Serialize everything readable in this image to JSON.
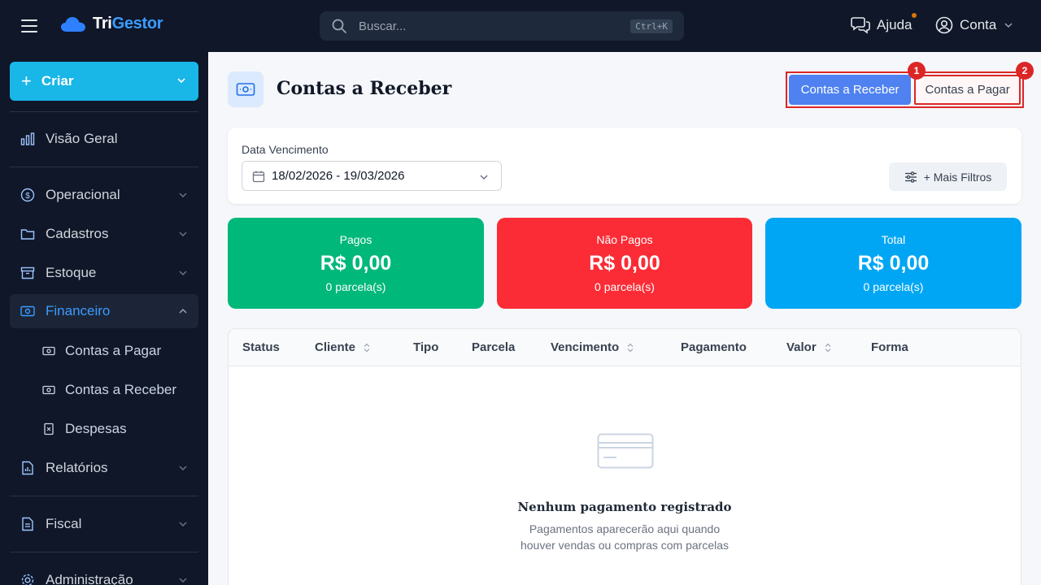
{
  "topbar": {
    "logo_prefix": "Tri",
    "logo_suffix": "Gestor",
    "search_placeholder": "Buscar...",
    "search_shortcut": "Ctrl+K",
    "help_label": "Ajuda",
    "account_label": "Conta"
  },
  "sidebar": {
    "create_label": "Criar",
    "items": {
      "visao_geral": "Visão Geral",
      "operacional": "Operacional",
      "cadastros": "Cadastros",
      "estoque": "Estoque",
      "financeiro": "Financeiro",
      "relatorios": "Relatórios",
      "fiscal": "Fiscal",
      "administracao": "Administração"
    },
    "financeiro_sub": {
      "contas_pagar": "Contas a Pagar",
      "contas_receber": "Contas a Receber",
      "despesas": "Despesas"
    }
  },
  "page": {
    "title": "Contas a Receber",
    "tabs": {
      "receber": "Contas a Receber",
      "pagar": "Contas a Pagar"
    },
    "badges": [
      "1",
      "2"
    ]
  },
  "filters": {
    "date_label": "Data Vencimento",
    "date_value": "18/02/2026 - 19/03/2026",
    "more_filters": "+ Mais Filtros"
  },
  "stats": {
    "pagos": {
      "label": "Pagos",
      "value": "R$ 0,00",
      "count": "0 parcela(s)",
      "color": "#00b879"
    },
    "nao_pagos": {
      "label": "Não Pagos",
      "value": "R$ 0,00",
      "count": "0 parcela(s)",
      "color": "#fb2c36"
    },
    "total": {
      "label": "Total",
      "value": "R$ 0,00",
      "count": "0 parcela(s)",
      "color": "#00a6f4"
    }
  },
  "table": {
    "columns": {
      "status": "Status",
      "cliente": "Cliente",
      "tipo": "Tipo",
      "parcela": "Parcela",
      "vencimento": "Vencimento",
      "pagamento": "Pagamento",
      "valor": "Valor",
      "forma": "Forma"
    },
    "empty_title": "Nenhum pagamento registrado",
    "empty_line1": "Pagamentos aparecerão aqui quando",
    "empty_line2": "houver vendas ou compras com parcelas"
  }
}
